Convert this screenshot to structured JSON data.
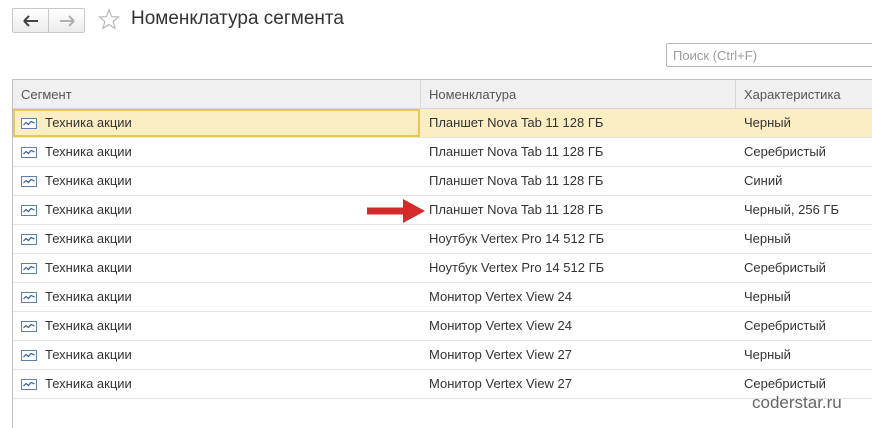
{
  "header": {
    "title": "Номенклатура сегмента",
    "back_icon": "arrow-left-icon",
    "forward_icon": "arrow-right-icon",
    "favorite_icon": "star-icon"
  },
  "search": {
    "placeholder": "Поиск (Ctrl+F)",
    "value": ""
  },
  "table": {
    "columns": [
      "Сегмент",
      "Номенклатура",
      "Характеристика"
    ],
    "selected_index": 0,
    "rows": [
      {
        "segment": "Техника акции",
        "item": "Планшет Nova Tab 11 128 ГБ",
        "characteristic": "Черный"
      },
      {
        "segment": "Техника акции",
        "item": "Планшет Nova Tab 11 128 ГБ",
        "characteristic": "Серебристый"
      },
      {
        "segment": "Техника акции",
        "item": "Планшет Nova Tab 11 128 ГБ",
        "characteristic": "Синий"
      },
      {
        "segment": "Техника акции",
        "item": "Планшет Nova Tab 11 128 ГБ",
        "characteristic": "Черный, 256 ГБ"
      },
      {
        "segment": "Техника акции",
        "item": "Ноутбук Vertex Pro 14 512 ГБ",
        "characteristic": "Черный"
      },
      {
        "segment": "Техника акции",
        "item": "Ноутбук Vertex Pro 14 512 ГБ",
        "characteristic": "Серебристый"
      },
      {
        "segment": "Техника акции",
        "item": "Монитор Vertex View 24",
        "characteristic": "Черный"
      },
      {
        "segment": "Техника акции",
        "item": "Монитор Vertex View 24",
        "characteristic": "Серебристый"
      },
      {
        "segment": "Техника акции",
        "item": "Монитор Vertex View 27",
        "characteristic": "Черный"
      },
      {
        "segment": "Техника акции",
        "item": "Монитор Vertex View 27",
        "characteristic": "Серебристый"
      }
    ]
  },
  "annotation": {
    "arrow_color": "#d42a2a",
    "arrow_icon": "red-arrow-icon"
  },
  "watermark": "coderstar.ru",
  "colors": {
    "selected_row": "#fbeec3",
    "selected_border": "#e6c75a",
    "header_bg": "#f0f0f0"
  }
}
